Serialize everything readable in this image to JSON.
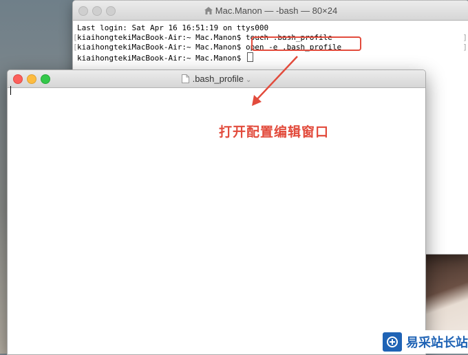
{
  "terminal": {
    "title": "Mac.Manon — -bash — 80×24",
    "lines": [
      "Last login: Sat Apr 16 16:51:19 on ttys000",
      "kiaihongtekiMacBook-Air:~ Mac.Manon$ touch .bash_profile",
      "kiaihongtekiMacBook-Air:~ Mac.Manon$ open -e .bash_profile",
      "kiaihongtekiMacBook-Air:~ Mac.Manon$ "
    ]
  },
  "editor": {
    "title": ".bash_profile"
  },
  "annotation": {
    "text": "打开配置编辑窗口",
    "color": "#e24b3c"
  },
  "watermark": {
    "text": "易采站长站"
  }
}
